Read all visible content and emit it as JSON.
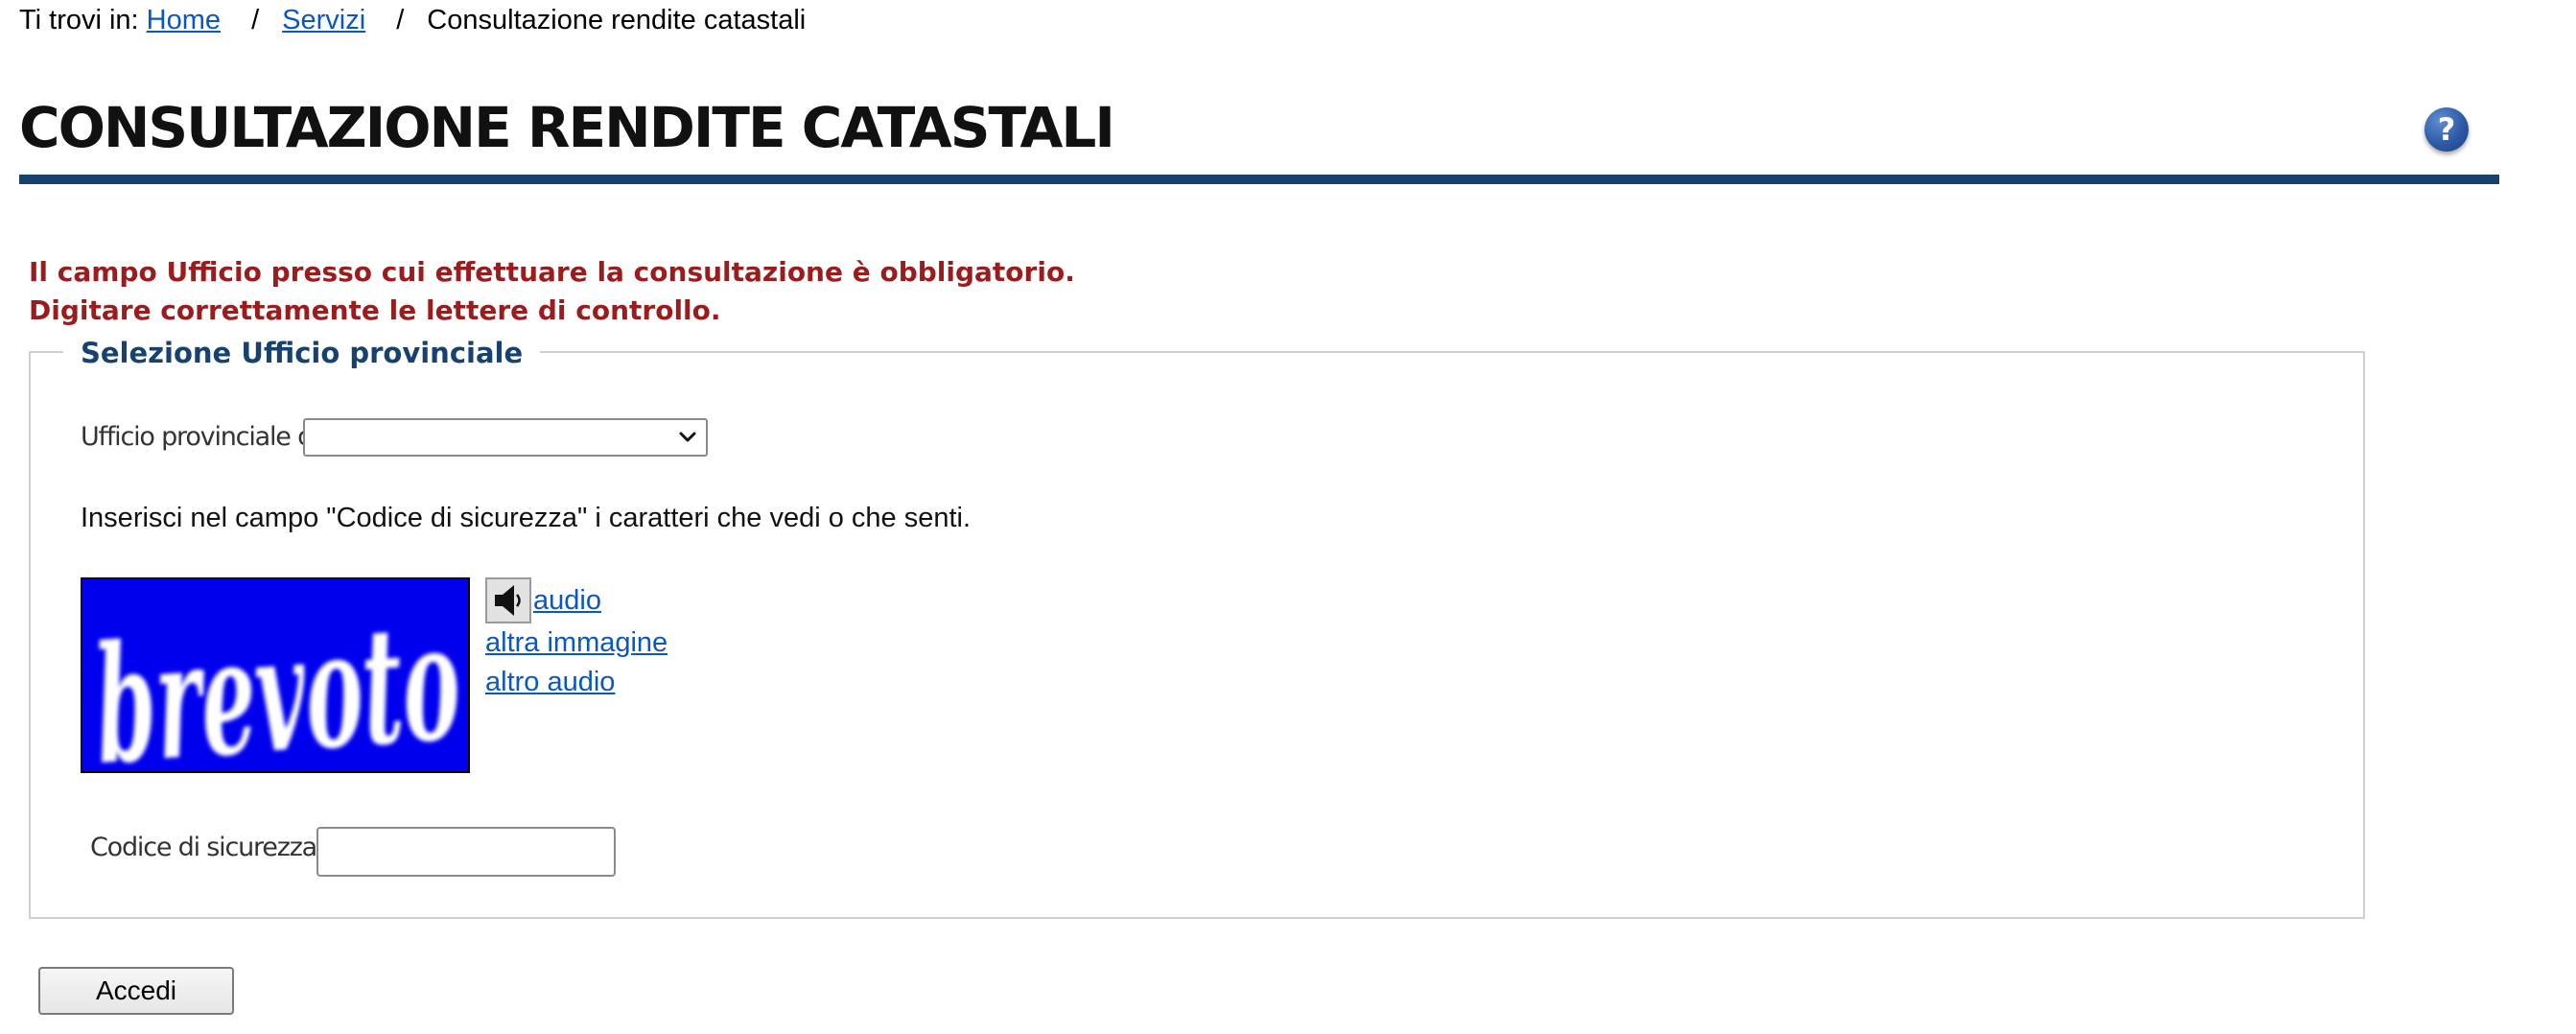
{
  "breadcrumb": {
    "prefix": "Ti trovi in:",
    "items": [
      {
        "label": "Home"
      },
      {
        "label": "Servizi"
      }
    ],
    "separator": "/",
    "current": "Consultazione rendite catastali"
  },
  "header": {
    "title": "CONSULTAZIONE RENDITE CATASTALI",
    "help_icon": "question-mark-icon",
    "help_symbol": "?"
  },
  "errors": [
    "Il campo Ufficio presso cui effettuare la consultazione è obbligatorio.",
    "Digitare correttamente le lettere di controllo."
  ],
  "form": {
    "legend": "Selezione Ufficio provinciale",
    "ufficio_label": "Ufficio provinciale di:",
    "ufficio_value": "",
    "instructions": "Inserisci nel campo \"Codice di sicurezza\" i caratteri che vedi o che senti.",
    "captcha_text": "brevoto",
    "audio_link": "audio",
    "altra_immagine_link": "altra immagine",
    "altro_audio_link": "altro audio",
    "codice_label": "Codice di sicurezza:",
    "codice_value": ""
  },
  "actions": {
    "submit_label": "Accedi"
  },
  "colors": {
    "rule": "#17416f",
    "error": "#9b1c1c",
    "link": "#0b56c5",
    "legend": "#17416f",
    "captcha_bg": "#0000ee"
  }
}
